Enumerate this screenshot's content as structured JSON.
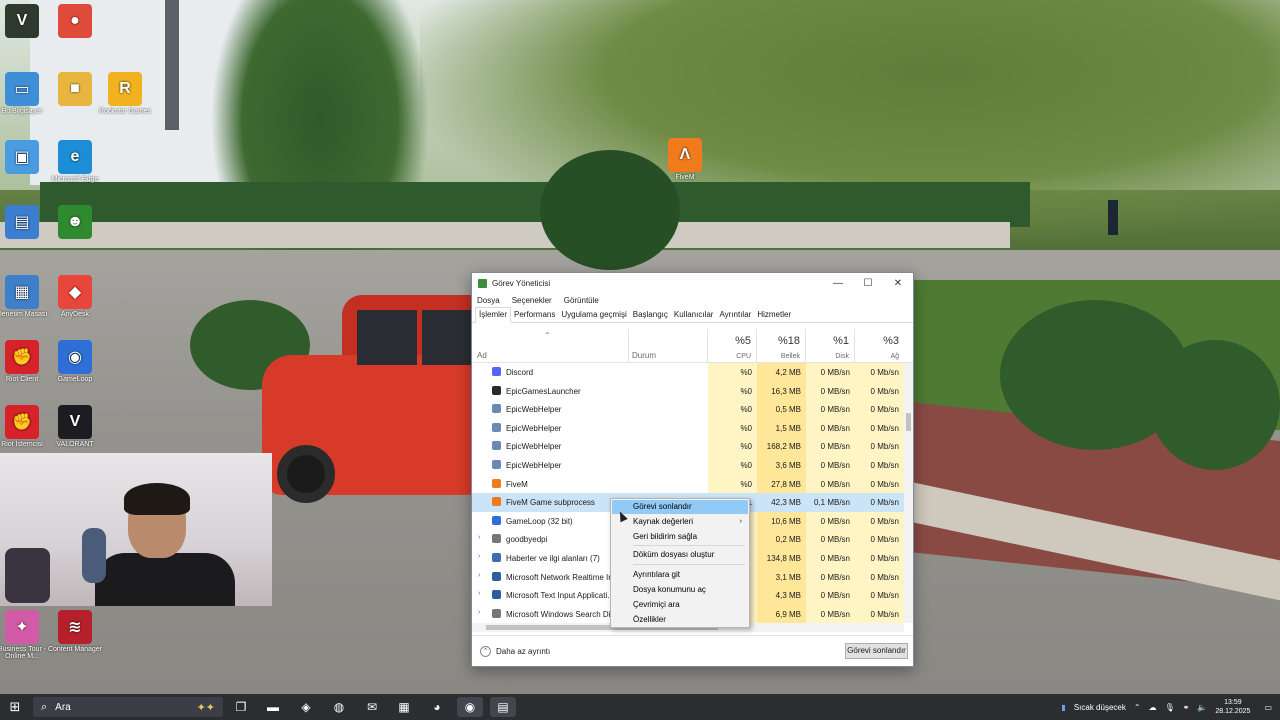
{
  "desktop": {
    "icons": [
      {
        "label": "",
        "name": "valorant-v-icon",
        "color": "#2e3a2e",
        "glyph": "V"
      },
      {
        "label": "",
        "name": "chrome-icon",
        "color": "#e04a3a",
        "glyph": "●"
      },
      {
        "label": "Bu Bilgisayar",
        "name": "this-pc-icon",
        "color": "#3f8fd6",
        "glyph": "▭"
      },
      {
        "label": "",
        "name": "folder-icon",
        "color": "#e8b640",
        "glyph": "■"
      },
      {
        "label": "Rockstar Games",
        "name": "rockstar-icon",
        "color": "#f0b21e",
        "glyph": "R"
      },
      {
        "label": "",
        "name": "recycle-bin-icon",
        "color": "#4b9be0",
        "glyph": "▣"
      },
      {
        "label": "Microsoft Edge",
        "name": "edge-icon",
        "color": "#1c8ed6",
        "glyph": "e"
      },
      {
        "label": "",
        "name": "app-icon",
        "color": "#3b7ed1",
        "glyph": "▤"
      },
      {
        "label": "",
        "name": "green-alien-icon",
        "color": "#2f8a2f",
        "glyph": "☻"
      },
      {
        "label": "Denetim Masası",
        "name": "control-panel-icon",
        "color": "#3d7fc8",
        "glyph": "▦"
      },
      {
        "label": "AnyDesk",
        "name": "anydesk-icon",
        "color": "#e8463a",
        "glyph": "◆"
      },
      {
        "label": "Riot Client",
        "name": "riot-client-icon",
        "color": "#d8222a",
        "glyph": "✊"
      },
      {
        "label": "GameLoop",
        "name": "gameloop-icon",
        "color": "#2d6fd6",
        "glyph": "◉"
      },
      {
        "label": "Riot İstemcisi",
        "name": "riot-client-2-icon",
        "color": "#d8222a",
        "glyph": "✊"
      },
      {
        "label": "VALORANT",
        "name": "valorant-icon",
        "color": "#1c1c22",
        "glyph": "V"
      },
      {
        "label": "Business Tour - Online M...",
        "name": "business-tour-icon",
        "color": "#d35aa6",
        "glyph": "✦"
      },
      {
        "label": "Content Manager",
        "name": "content-manager-icon",
        "color": "#b5202a",
        "glyph": "≋"
      },
      {
        "label": "FiveM",
        "name": "fivem-desktop-icon",
        "color": "#f07a1c",
        "glyph": "Λ"
      }
    ]
  },
  "taskmgr": {
    "title": "Görev Yöneticisi",
    "controls": {
      "minimize": "—",
      "maximize": "☐",
      "close": "✕"
    },
    "menu": [
      "Dosya",
      "Seçenekler",
      "Görüntüle"
    ],
    "tabs": [
      "İşlemler",
      "Performans",
      "Uygulama geçmişi",
      "Başlangıç",
      "Kullanıcılar",
      "Ayrıntılar",
      "Hizmetler"
    ],
    "columns": {
      "name": "Ad",
      "status": "Durum",
      "cpu": {
        "pct": "%5",
        "label": "CPU"
      },
      "mem": {
        "pct": "%18",
        "label": "Bellek"
      },
      "disk": {
        "pct": "%1",
        "label": "Disk"
      },
      "net": {
        "pct": "%3",
        "label": "Ağ"
      }
    },
    "rows": [
      {
        "name": "Discord",
        "icon": "discord-icon",
        "color": "#5865f2",
        "expand": "",
        "cpu": "%0",
        "mem": "4,2 MB",
        "disk": "0 MB/sn",
        "net": "0 Mb/sn"
      },
      {
        "name": "EpicGamesLauncher",
        "icon": "epic-icon",
        "color": "#2a2a2a",
        "expand": "",
        "cpu": "%0",
        "mem": "16,3 MB",
        "disk": "0 MB/sn",
        "net": "0 Mb/sn"
      },
      {
        "name": "EpicWebHelper",
        "icon": "epic-web-icon",
        "color": "#6a8ab5",
        "expand": "",
        "cpu": "%0",
        "mem": "0,5 MB",
        "disk": "0 MB/sn",
        "net": "0 Mb/sn"
      },
      {
        "name": "EpicWebHelper",
        "icon": "epic-web-icon",
        "color": "#6a8ab5",
        "expand": "",
        "cpu": "%0",
        "mem": "1,5 MB",
        "disk": "0 MB/sn",
        "net": "0 Mb/sn"
      },
      {
        "name": "EpicWebHelper",
        "icon": "epic-web-icon",
        "color": "#6a8ab5",
        "expand": "",
        "cpu": "%0",
        "mem": "168,2 MB",
        "disk": "0 MB/sn",
        "net": "0 Mb/sn"
      },
      {
        "name": "EpicWebHelper",
        "icon": "epic-web-icon",
        "color": "#6a8ab5",
        "expand": "",
        "cpu": "%0",
        "mem": "3,6 MB",
        "disk": "0 MB/sn",
        "net": "0 Mb/sn"
      },
      {
        "name": "FiveM",
        "icon": "fivem-icon",
        "color": "#f07a1c",
        "expand": "",
        "cpu": "%0",
        "mem": "27,8 MB",
        "disk": "0 MB/sn",
        "net": "0 Mb/sn"
      },
      {
        "name": "FiveM Game subprocess",
        "icon": "fivem-icon",
        "color": "#f07a1c",
        "expand": "",
        "cpu": "%1,1",
        "mem": "42,3 MB",
        "disk": "0,1 MB/sn",
        "net": "0 Mb/sn",
        "selected": true
      },
      {
        "name": "GameLoop (32 bit)",
        "icon": "gameloop-icon",
        "color": "#2d6fd6",
        "expand": "",
        "cpu": "",
        "mem": "10,6 MB",
        "disk": "0 MB/sn",
        "net": "0 Mb/sn"
      },
      {
        "name": "goodbyedpi",
        "icon": "gear-icon",
        "color": "#777",
        "expand": "›",
        "cpu": "",
        "mem": "0,2 MB",
        "disk": "0 MB/sn",
        "net": "0 Mb/sn"
      },
      {
        "name": "Haberler ve ilgi alanları (7)",
        "icon": "news-icon",
        "color": "#3a6fb0",
        "expand": "›",
        "cpu": "",
        "mem": "134,8 MB",
        "disk": "0 MB/sn",
        "net": "0 Mb/sn"
      },
      {
        "name": "Microsoft Network Realtime Ins...",
        "icon": "ms-icon",
        "color": "#2a5f9e",
        "expand": "›",
        "cpu": "",
        "mem": "3,1 MB",
        "disk": "0 MB/sn",
        "net": "0 Mb/sn"
      },
      {
        "name": "Microsoft Text Input Applicati...",
        "icon": "ms-icon",
        "color": "#2a5f9e",
        "expand": "›",
        "cpu": "",
        "mem": "4,3 MB",
        "disk": "0 MB/sn",
        "net": "0 Mb/sn"
      },
      {
        "name": "Microsoft Windows Search Dis...",
        "icon": "search-user-icon",
        "color": "#777",
        "expand": "›",
        "cpu": "",
        "mem": "6,9 MB",
        "disk": "0 MB/sn",
        "net": "0 Mb/sn"
      }
    ],
    "footer": {
      "less": "Daha az ayrıntı",
      "end": "Görevi sonlandır"
    }
  },
  "context_menu": {
    "items": [
      {
        "label": "Görevi sonlandır",
        "highlight": true
      },
      {
        "label": "Kaynak değerleri",
        "arrow": "›"
      },
      {
        "label": "Geri bildirim sağla"
      },
      {
        "label": "Döküm dosyası oluştur"
      },
      {
        "label": "Ayrıntılara git"
      },
      {
        "label": "Dosya konumunu aç"
      },
      {
        "label": "Çevrimiçi ara"
      },
      {
        "label": "Özellikler"
      }
    ]
  },
  "taskbar": {
    "search_placeholder": "Ara",
    "apps": [
      {
        "name": "task-view-icon",
        "glyph": "❐"
      },
      {
        "name": "file-explorer-icon",
        "glyph": "▬"
      },
      {
        "name": "copilot-icon",
        "glyph": "◈"
      },
      {
        "name": "edge-taskbar-icon",
        "glyph": "◍"
      },
      {
        "name": "outlook-icon",
        "glyph": "✉"
      },
      {
        "name": "store-icon",
        "glyph": "▦"
      },
      {
        "name": "discord-taskbar-icon",
        "glyph": "◕"
      },
      {
        "name": "obs-icon",
        "glyph": "◉"
      },
      {
        "name": "task-manager-taskbar-icon",
        "glyph": "▤"
      }
    ],
    "weather": "Sıcak düşecek",
    "time": "13:59",
    "date": "28.12.2025"
  }
}
